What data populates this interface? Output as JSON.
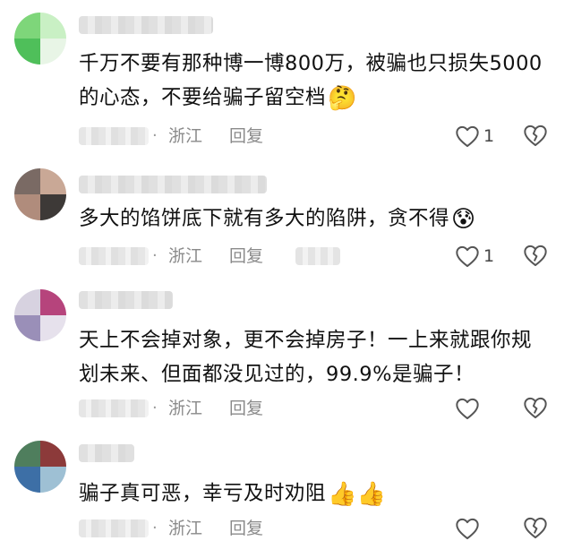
{
  "comments": [
    {
      "text": "千万不要有那种博一博800万，被骗也只损失5000的心态，不要给骗子留空档",
      "emoji": "🤔",
      "region": "浙江",
      "reply_label": "回复",
      "like_count": "1",
      "avatar_colors": [
        "#7ed67a",
        "#c9f0c4",
        "#4fbf5a",
        "#e8f5e6"
      ]
    },
    {
      "text": "多大的馅饼底下就有多大的陷阱，贪不得",
      "emoji": "😰",
      "region": "浙江",
      "reply_label": "回复",
      "like_count": "1",
      "avatar_colors": [
        "#7a6a64",
        "#c9a896",
        "#b08c7c",
        "#3d3937"
      ]
    },
    {
      "text": "天上不会掉对象，更不会掉房子！一上来就跟你规划未来、但面都没见过的，99.9%是骗子！",
      "emoji": "",
      "region": "浙江",
      "reply_label": "回复",
      "like_count": "",
      "avatar_colors": [
        "#d7d2e0",
        "#b6447c",
        "#9a8fb8",
        "#e6e1ec"
      ]
    },
    {
      "text": "骗子真可恶，幸亏及时劝阻",
      "emoji": "👍👍",
      "region": "浙江",
      "reply_label": "回复",
      "like_count": "",
      "avatar_colors": [
        "#4f7e5d",
        "#8c3a3a",
        "#3d6fa6",
        "#9ec0d4"
      ]
    }
  ],
  "colors": {
    "meta_text": "#8a8a8a",
    "icon_stroke": "#555555"
  }
}
